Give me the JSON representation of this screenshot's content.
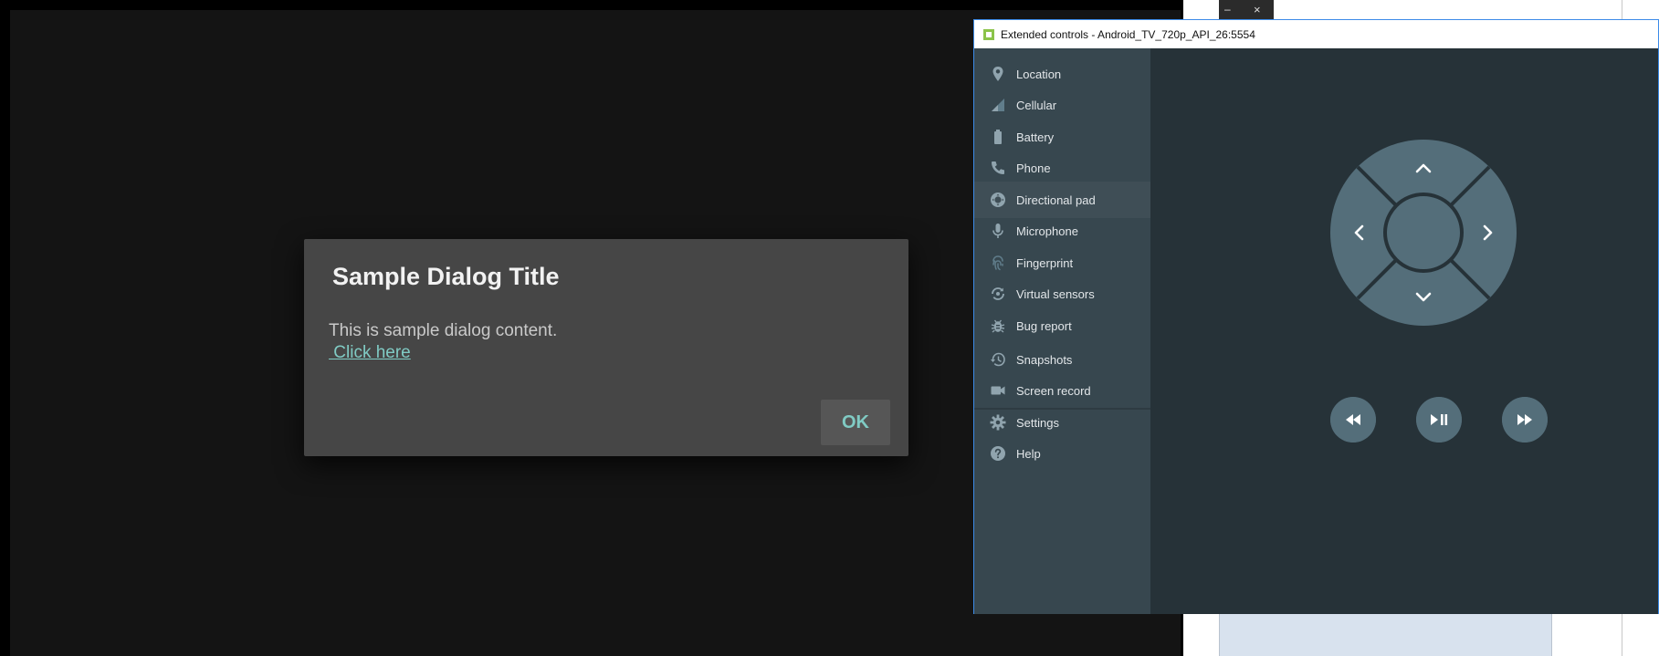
{
  "emulator": {
    "dialog": {
      "title": "Sample Dialog Title",
      "content": "This is sample dialog content.",
      "link": " Click here",
      "ok_label": "OK"
    }
  },
  "background_window": {
    "minimize_glyph": "–",
    "close_glyph": "×"
  },
  "extended_controls": {
    "title": "Extended controls - Android_TV_720p_API_26:5554",
    "active_item": "Directional pad",
    "sidebar": {
      "items": [
        {
          "label": "Location",
          "icon": "location-pin-icon"
        },
        {
          "label": "Cellular",
          "icon": "signal-icon"
        },
        {
          "label": "Battery",
          "icon": "battery-icon"
        },
        {
          "label": "Phone",
          "icon": "phone-icon"
        },
        {
          "label": "Directional pad",
          "icon": "dpad-icon"
        },
        {
          "label": "Microphone",
          "icon": "microphone-icon"
        },
        {
          "label": "Fingerprint",
          "icon": "fingerprint-icon"
        },
        {
          "label": "Virtual sensors",
          "icon": "rotate-icon"
        },
        {
          "label": "Bug report",
          "icon": "bug-icon"
        },
        {
          "label": "Snapshots",
          "icon": "history-icon"
        },
        {
          "label": "Screen record",
          "icon": "videocam-icon"
        },
        {
          "label": "Settings",
          "icon": "gear-icon"
        },
        {
          "label": "Help",
          "icon": "help-icon"
        }
      ]
    },
    "dpad": {
      "buttons": [
        "up",
        "down",
        "left",
        "right",
        "center"
      ],
      "media_buttons": [
        "rewind",
        "play-pause",
        "fast-forward"
      ]
    }
  },
  "colors": {
    "sidebar": "#37474f",
    "main": "#263238",
    "dpad": "#546e7a",
    "accent": "#80cbc4"
  }
}
